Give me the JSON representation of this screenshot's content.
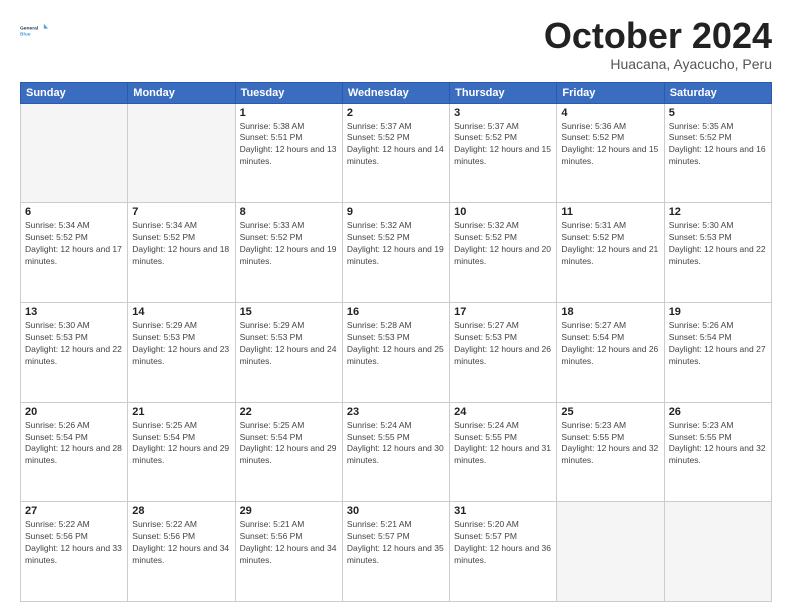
{
  "header": {
    "logo_general": "General",
    "logo_blue": "Blue",
    "month_title": "October 2024",
    "subtitle": "Huacana, Ayacucho, Peru"
  },
  "days_of_week": [
    "Sunday",
    "Monday",
    "Tuesday",
    "Wednesday",
    "Thursday",
    "Friday",
    "Saturday"
  ],
  "weeks": [
    [
      {
        "day": "",
        "sunrise": "",
        "sunset": "",
        "daylight": "",
        "empty": true
      },
      {
        "day": "",
        "sunrise": "",
        "sunset": "",
        "daylight": "",
        "empty": true
      },
      {
        "day": "1",
        "sunrise": "Sunrise: 5:38 AM",
        "sunset": "Sunset: 5:51 PM",
        "daylight": "Daylight: 12 hours and 13 minutes.",
        "empty": false
      },
      {
        "day": "2",
        "sunrise": "Sunrise: 5:37 AM",
        "sunset": "Sunset: 5:52 PM",
        "daylight": "Daylight: 12 hours and 14 minutes.",
        "empty": false
      },
      {
        "day": "3",
        "sunrise": "Sunrise: 5:37 AM",
        "sunset": "Sunset: 5:52 PM",
        "daylight": "Daylight: 12 hours and 15 minutes.",
        "empty": false
      },
      {
        "day": "4",
        "sunrise": "Sunrise: 5:36 AM",
        "sunset": "Sunset: 5:52 PM",
        "daylight": "Daylight: 12 hours and 15 minutes.",
        "empty": false
      },
      {
        "day": "5",
        "sunrise": "Sunrise: 5:35 AM",
        "sunset": "Sunset: 5:52 PM",
        "daylight": "Daylight: 12 hours and 16 minutes.",
        "empty": false
      }
    ],
    [
      {
        "day": "6",
        "sunrise": "Sunrise: 5:34 AM",
        "sunset": "Sunset: 5:52 PM",
        "daylight": "Daylight: 12 hours and 17 minutes.",
        "empty": false
      },
      {
        "day": "7",
        "sunrise": "Sunrise: 5:34 AM",
        "sunset": "Sunset: 5:52 PM",
        "daylight": "Daylight: 12 hours and 18 minutes.",
        "empty": false
      },
      {
        "day": "8",
        "sunrise": "Sunrise: 5:33 AM",
        "sunset": "Sunset: 5:52 PM",
        "daylight": "Daylight: 12 hours and 19 minutes.",
        "empty": false
      },
      {
        "day": "9",
        "sunrise": "Sunrise: 5:32 AM",
        "sunset": "Sunset: 5:52 PM",
        "daylight": "Daylight: 12 hours and 19 minutes.",
        "empty": false
      },
      {
        "day": "10",
        "sunrise": "Sunrise: 5:32 AM",
        "sunset": "Sunset: 5:52 PM",
        "daylight": "Daylight: 12 hours and 20 minutes.",
        "empty": false
      },
      {
        "day": "11",
        "sunrise": "Sunrise: 5:31 AM",
        "sunset": "Sunset: 5:52 PM",
        "daylight": "Daylight: 12 hours and 21 minutes.",
        "empty": false
      },
      {
        "day": "12",
        "sunrise": "Sunrise: 5:30 AM",
        "sunset": "Sunset: 5:53 PM",
        "daylight": "Daylight: 12 hours and 22 minutes.",
        "empty": false
      }
    ],
    [
      {
        "day": "13",
        "sunrise": "Sunrise: 5:30 AM",
        "sunset": "Sunset: 5:53 PM",
        "daylight": "Daylight: 12 hours and 22 minutes.",
        "empty": false
      },
      {
        "day": "14",
        "sunrise": "Sunrise: 5:29 AM",
        "sunset": "Sunset: 5:53 PM",
        "daylight": "Daylight: 12 hours and 23 minutes.",
        "empty": false
      },
      {
        "day": "15",
        "sunrise": "Sunrise: 5:29 AM",
        "sunset": "Sunset: 5:53 PM",
        "daylight": "Daylight: 12 hours and 24 minutes.",
        "empty": false
      },
      {
        "day": "16",
        "sunrise": "Sunrise: 5:28 AM",
        "sunset": "Sunset: 5:53 PM",
        "daylight": "Daylight: 12 hours and 25 minutes.",
        "empty": false
      },
      {
        "day": "17",
        "sunrise": "Sunrise: 5:27 AM",
        "sunset": "Sunset: 5:53 PM",
        "daylight": "Daylight: 12 hours and 26 minutes.",
        "empty": false
      },
      {
        "day": "18",
        "sunrise": "Sunrise: 5:27 AM",
        "sunset": "Sunset: 5:54 PM",
        "daylight": "Daylight: 12 hours and 26 minutes.",
        "empty": false
      },
      {
        "day": "19",
        "sunrise": "Sunrise: 5:26 AM",
        "sunset": "Sunset: 5:54 PM",
        "daylight": "Daylight: 12 hours and 27 minutes.",
        "empty": false
      }
    ],
    [
      {
        "day": "20",
        "sunrise": "Sunrise: 5:26 AM",
        "sunset": "Sunset: 5:54 PM",
        "daylight": "Daylight: 12 hours and 28 minutes.",
        "empty": false
      },
      {
        "day": "21",
        "sunrise": "Sunrise: 5:25 AM",
        "sunset": "Sunset: 5:54 PM",
        "daylight": "Daylight: 12 hours and 29 minutes.",
        "empty": false
      },
      {
        "day": "22",
        "sunrise": "Sunrise: 5:25 AM",
        "sunset": "Sunset: 5:54 PM",
        "daylight": "Daylight: 12 hours and 29 minutes.",
        "empty": false
      },
      {
        "day": "23",
        "sunrise": "Sunrise: 5:24 AM",
        "sunset": "Sunset: 5:55 PM",
        "daylight": "Daylight: 12 hours and 30 minutes.",
        "empty": false
      },
      {
        "day": "24",
        "sunrise": "Sunrise: 5:24 AM",
        "sunset": "Sunset: 5:55 PM",
        "daylight": "Daylight: 12 hours and 31 minutes.",
        "empty": false
      },
      {
        "day": "25",
        "sunrise": "Sunrise: 5:23 AM",
        "sunset": "Sunset: 5:55 PM",
        "daylight": "Daylight: 12 hours and 32 minutes.",
        "empty": false
      },
      {
        "day": "26",
        "sunrise": "Sunrise: 5:23 AM",
        "sunset": "Sunset: 5:55 PM",
        "daylight": "Daylight: 12 hours and 32 minutes.",
        "empty": false
      }
    ],
    [
      {
        "day": "27",
        "sunrise": "Sunrise: 5:22 AM",
        "sunset": "Sunset: 5:56 PM",
        "daylight": "Daylight: 12 hours and 33 minutes.",
        "empty": false
      },
      {
        "day": "28",
        "sunrise": "Sunrise: 5:22 AM",
        "sunset": "Sunset: 5:56 PM",
        "daylight": "Daylight: 12 hours and 34 minutes.",
        "empty": false
      },
      {
        "day": "29",
        "sunrise": "Sunrise: 5:21 AM",
        "sunset": "Sunset: 5:56 PM",
        "daylight": "Daylight: 12 hours and 34 minutes.",
        "empty": false
      },
      {
        "day": "30",
        "sunrise": "Sunrise: 5:21 AM",
        "sunset": "Sunset: 5:57 PM",
        "daylight": "Daylight: 12 hours and 35 minutes.",
        "empty": false
      },
      {
        "day": "31",
        "sunrise": "Sunrise: 5:20 AM",
        "sunset": "Sunset: 5:57 PM",
        "daylight": "Daylight: 12 hours and 36 minutes.",
        "empty": false
      },
      {
        "day": "",
        "sunrise": "",
        "sunset": "",
        "daylight": "",
        "empty": true
      },
      {
        "day": "",
        "sunrise": "",
        "sunset": "",
        "daylight": "",
        "empty": true
      }
    ]
  ]
}
